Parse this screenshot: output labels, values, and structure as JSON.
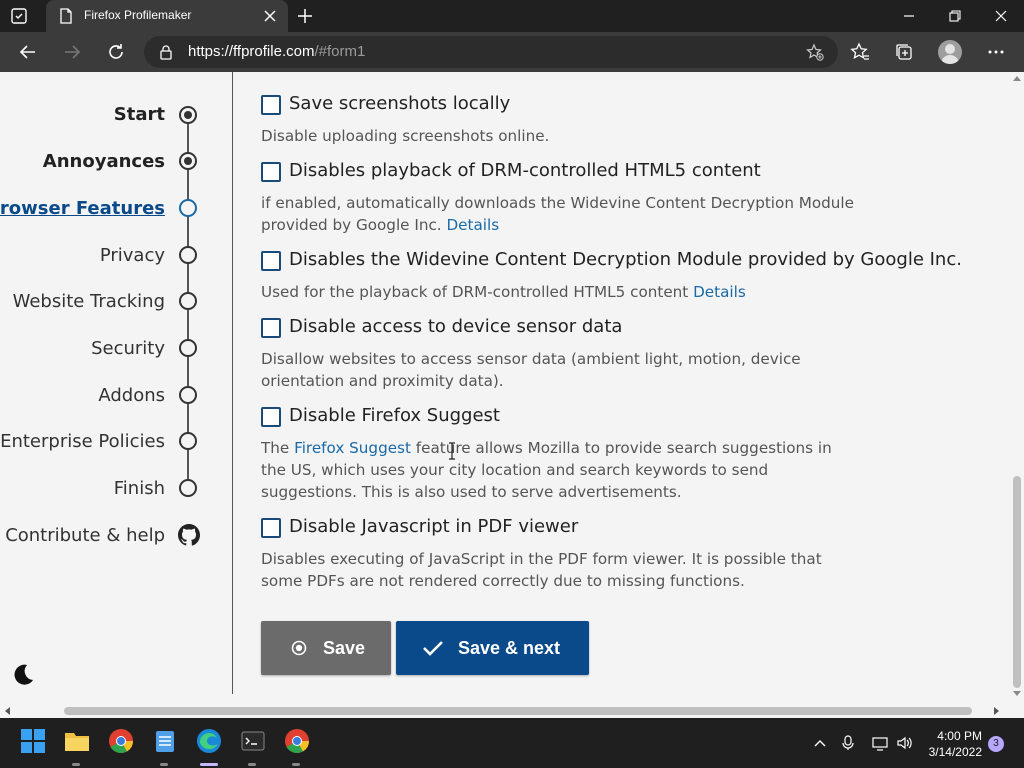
{
  "browser": {
    "tab_title": "Firefox Profilemaker",
    "url_host": "https://ffprofile.com",
    "url_path": "/#form1"
  },
  "sidebar": {
    "items": [
      {
        "label": "Start"
      },
      {
        "label": "Annoyances"
      },
      {
        "label": "Browser Features"
      },
      {
        "label": "Privacy"
      },
      {
        "label": "Website Tracking"
      },
      {
        "label": "Security"
      },
      {
        "label": "Addons"
      },
      {
        "label": "Enterprise Policies"
      },
      {
        "label": "Finish"
      },
      {
        "label": "Contribute & help"
      }
    ]
  },
  "options": [
    {
      "label": "Save screenshots locally",
      "desc": "Disable uploading screenshots online.",
      "checked": false
    },
    {
      "label": "Disables playback of DRM-controlled HTML5 content",
      "desc": "if enabled, automatically downloads the Widevine Content Decryption Module provided by Google Inc.",
      "link": "Details",
      "checked": false
    },
    {
      "label": "Disables the Widevine Content Decryption Module provided by Google Inc.",
      "desc": "Used for the playback of DRM-controlled HTML5 content",
      "link": "Details",
      "checked": false
    },
    {
      "label": "Disable access to device sensor data",
      "desc": "Disallow websites to access sensor data (ambient light, motion, device orientation and proximity data).",
      "checked": false
    },
    {
      "label": "Disable Firefox Suggest",
      "desc_pre": "The",
      "link": "Firefox Suggest",
      "desc_post": "feature allows Mozilla to provide search suggestions in the US, which uses your city location and search keywords to send suggestions. This is also used to serve advertisements.",
      "checked": false
    },
    {
      "label": "Disable Javascript in PDF viewer",
      "desc": "Disables executing of JavaScript in the PDF form viewer. It is possible that some PDFs are not rendered correctly due to missing functions.",
      "checked": false
    }
  ],
  "buttons": {
    "save": "Save",
    "save_next": "Save & next"
  },
  "taskbar": {
    "time": "4:00 PM",
    "date": "3/14/2022",
    "notifications": "3"
  },
  "colors": {
    "accent": "#0a4a8a",
    "link": "#1a6aa8",
    "save_button": "#6b6b6b"
  }
}
